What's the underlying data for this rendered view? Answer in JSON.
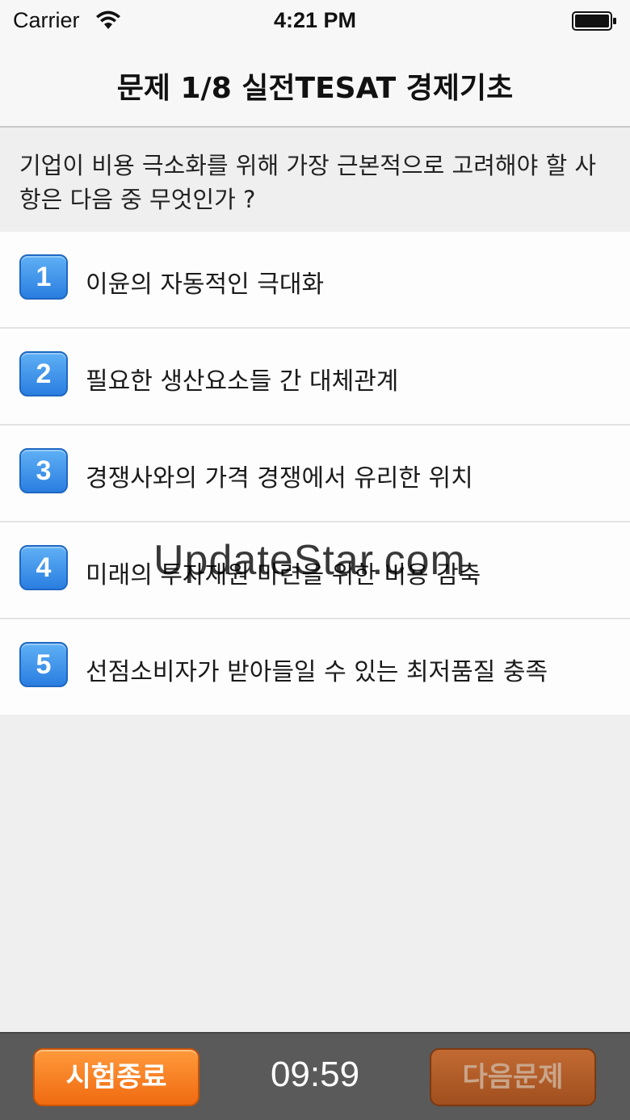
{
  "status_bar": {
    "carrier": "Carrier",
    "time": "4:21 PM",
    "wifi_icon": "wifi-icon",
    "battery_icon": "battery-icon"
  },
  "nav": {
    "title": "문제 1/8 실전TESAT 경제기초"
  },
  "question": {
    "text": "기업이 비용 극소화를 위해 가장 근본적으로 고려해야 할 사항은 다음 중 무엇인가 ?"
  },
  "options": [
    {
      "number": "1",
      "label": "이윤의 자동적인 극대화"
    },
    {
      "number": "2",
      "label": "필요한 생산요소들 간 대체관계"
    },
    {
      "number": "3",
      "label": "경쟁사와의 가격 경쟁에서 유리한 위치"
    },
    {
      "number": "4",
      "label": "미래의 투자재원 마련을 위한 비용 감축"
    },
    {
      "number": "5",
      "label": "선점소비자가 받아들일 수 있는 최저품질 충족"
    }
  ],
  "watermark": "UpdateStar.com",
  "toolbar": {
    "end_label": "시험종료",
    "timer": "09:59",
    "next_label": "다음문제"
  },
  "colors": {
    "badge_blue": "#2a7ee0",
    "end_orange": "#f06a10",
    "next_brown": "#a04f1e",
    "toolbar_bg": "#5a5a5a"
  }
}
